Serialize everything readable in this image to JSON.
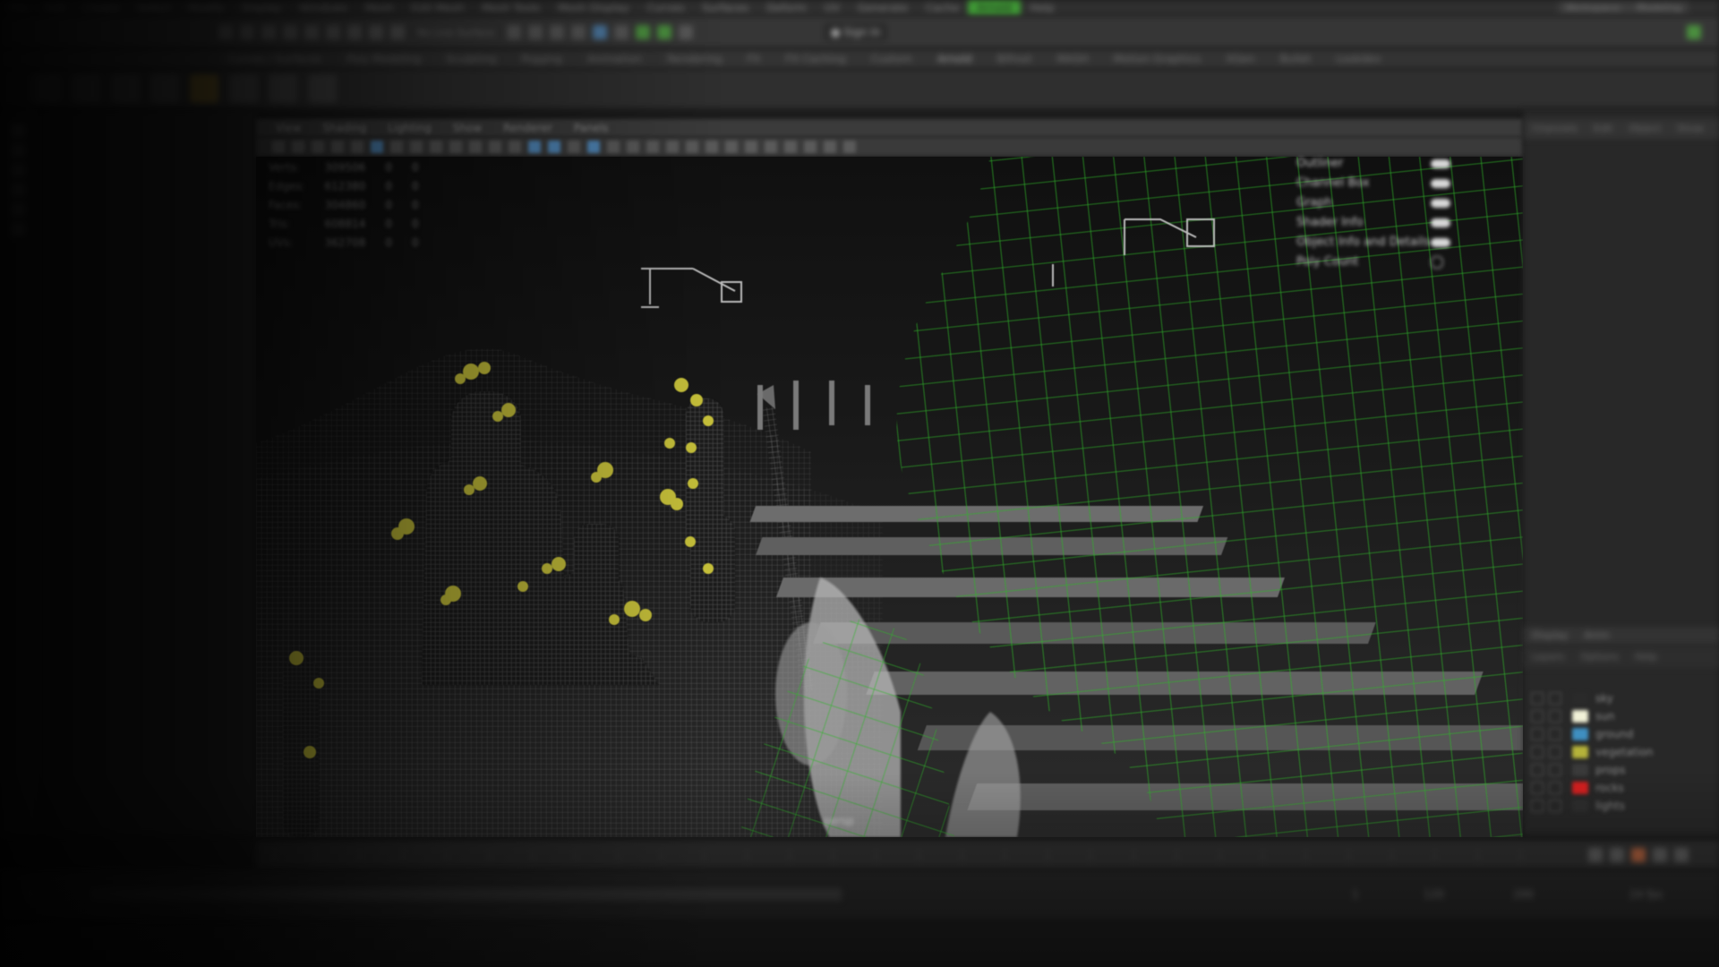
{
  "menubar": {
    "items": [
      "File",
      "Edit",
      "Create",
      "Select",
      "Modify",
      "Display",
      "Windows",
      "Mesh",
      "Edit Mesh",
      "Mesh Tools",
      "Mesh Display",
      "Curves",
      "Surfaces",
      "Deform",
      "UV",
      "Generate",
      "Cache",
      "Arnold",
      "Help"
    ],
    "active_index": 17,
    "workspace_label": "Workspace:",
    "workspace_value": "Modeling"
  },
  "statusline": {
    "mode_dropdown": "Modeling",
    "no_live_surface": "No Live Surface",
    "login_label": "Sign In"
  },
  "shelf": {
    "tabs": [
      "Curves / Surfaces",
      "Poly Modeling",
      "Sculpting",
      "Rigging",
      "Animation",
      "Rendering",
      "FX",
      "FX Caching",
      "Custom",
      "Arnold",
      "Bifrost",
      "MASH",
      "Motion Graphics",
      "XGen",
      "Bullet",
      "Lookdev"
    ],
    "active_index": 9
  },
  "viewport": {
    "menus": [
      "View",
      "Shading",
      "Lighting",
      "Show",
      "Renderer",
      "Panels"
    ],
    "camera_label": "persp",
    "hud_stats": [
      {
        "label": "Verts:",
        "value": "309506",
        "sel": "0",
        "sel2": "0"
      },
      {
        "label": "Edges:",
        "value": "612380",
        "sel": "0",
        "sel2": "0"
      },
      {
        "label": "Faces:",
        "value": "304860",
        "sel": "0",
        "sel2": "0"
      },
      {
        "label": "Tris:",
        "value": "608814",
        "sel": "0",
        "sel2": "0"
      },
      {
        "label": "UVs:",
        "value": "362708",
        "sel": "0",
        "sel2": "0"
      }
    ],
    "hud_right": [
      {
        "label": "Outliner",
        "on": true
      },
      {
        "label": "Channel Box",
        "on": true
      },
      {
        "label": "Graph",
        "on": true
      },
      {
        "label": "Shader Info",
        "on": true
      },
      {
        "label": "Object Info and Details",
        "on": true
      },
      {
        "label": "Poly Count",
        "on": false
      }
    ]
  },
  "rightpanel": {
    "tabs": [
      "Channels",
      "Edit",
      "Object",
      "Show"
    ],
    "layer_tabs": [
      "Display",
      "Anim"
    ],
    "layer_menu": [
      "Layers",
      "Options",
      "Help"
    ],
    "layers": [
      {
        "name": "sky",
        "color": "#2a2a2a",
        "visible": true
      },
      {
        "name": "sun",
        "color": "#f2f2d8",
        "visible": true
      },
      {
        "name": "ground",
        "color": "#3f8fc0",
        "visible": true
      },
      {
        "name": "vegetation",
        "color": "#b5b33a",
        "visible": true
      },
      {
        "name": "props",
        "color": "#3a3a3a",
        "visible": true
      },
      {
        "name": "rocks",
        "color": "#d42020",
        "visible": true
      },
      {
        "name": "lights",
        "color": "#2f2f2f",
        "visible": true
      }
    ]
  },
  "timeline": {
    "start": "1",
    "end": "120",
    "current": "1",
    "range_start": "1",
    "range_end": "200",
    "fps_label": "24 fps"
  },
  "colors": {
    "accent_green": "#3f9a35",
    "wire_green": "#2fb52a",
    "wire_grey": "#8c8c8c",
    "foliage_yellow": "#c8c23a"
  }
}
